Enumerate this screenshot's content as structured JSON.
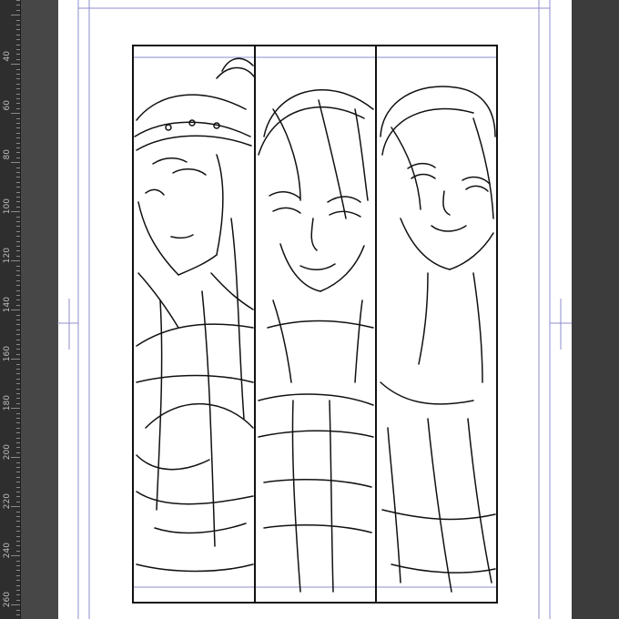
{
  "ruler": {
    "labels": [
      "40",
      "60",
      "80",
      "100",
      "120",
      "140",
      "160",
      "180",
      "200",
      "220",
      "240",
      "260"
    ]
  },
  "colors": {
    "guide": "#8c8ccc",
    "ink": "#111111",
    "ruler_bg": "#2e2e2e",
    "workspace_bg": "#3c3c3c"
  },
  "artwork": {
    "panels": [
      "left-figure-headband",
      "center-figure",
      "right-figure-smiling"
    ]
  }
}
